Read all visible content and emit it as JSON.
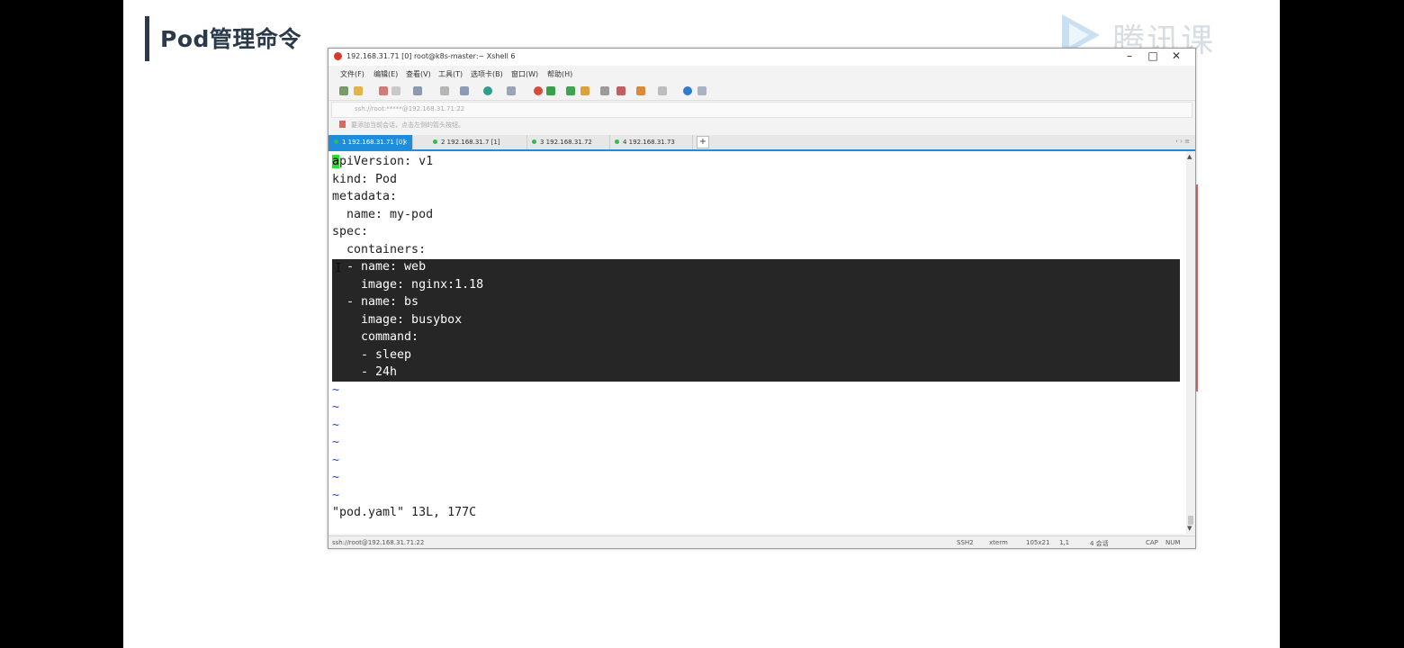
{
  "slide": {
    "title": "Pod管理命令",
    "watermark": "腾讯课堂"
  },
  "window": {
    "title": "192.168.31.71 [0]   root@k8s-master:~   Xshell 6",
    "controls": [
      "–",
      "□",
      "✕"
    ]
  },
  "menu": [
    "文件(F)",
    "编辑(E)",
    "查看(V)",
    "工具(T)",
    "选项卡(B)",
    "窗口(W)",
    "帮助(H)"
  ],
  "address_bar": {
    "value": "ssh://root:*****@192.168.31.71:22"
  },
  "hint_bar": {
    "text": "要添加当前会话，点击左侧的箭头按钮。"
  },
  "tabs": [
    {
      "label": "1 192.168.31.71 [0]",
      "active": true
    },
    {
      "label": "2 192.168.31.7  [1]",
      "active": false
    },
    {
      "label": "3 192.168.31.72",
      "active": false
    },
    {
      "label": "4 192.168.31.73",
      "active": false
    }
  ],
  "terminal": {
    "cursor_char": "a",
    "first_line_rest": "piVersion: v1",
    "lines": [
      "kind: Pod",
      "metadata:",
      "  name: my-pod",
      "spec:",
      "  containers:"
    ],
    "selected_lines": [
      "  - name: web",
      "    image: nginx:1.18",
      "  - name: bs",
      "    image: busybox",
      "    command:",
      "    - sleep",
      "    - 24h"
    ],
    "tilde": "~",
    "tilde_count": 7,
    "status_line": "\"pod.yaml\" 13L, 177C"
  },
  "statusbar": {
    "connection": "ssh://root@192.168.31.71:22",
    "ssh": "SSH2",
    "term": "xterm",
    "size": "105x21",
    "pos": "1,1",
    "sessions": "4 会话",
    "cap": "CAP",
    "num": "NUM"
  },
  "colors": {
    "selection_bg": "#262626",
    "cursor": "#2ede2e",
    "tilde": "#1f43c8",
    "tab_active": "#1e8ddb"
  }
}
